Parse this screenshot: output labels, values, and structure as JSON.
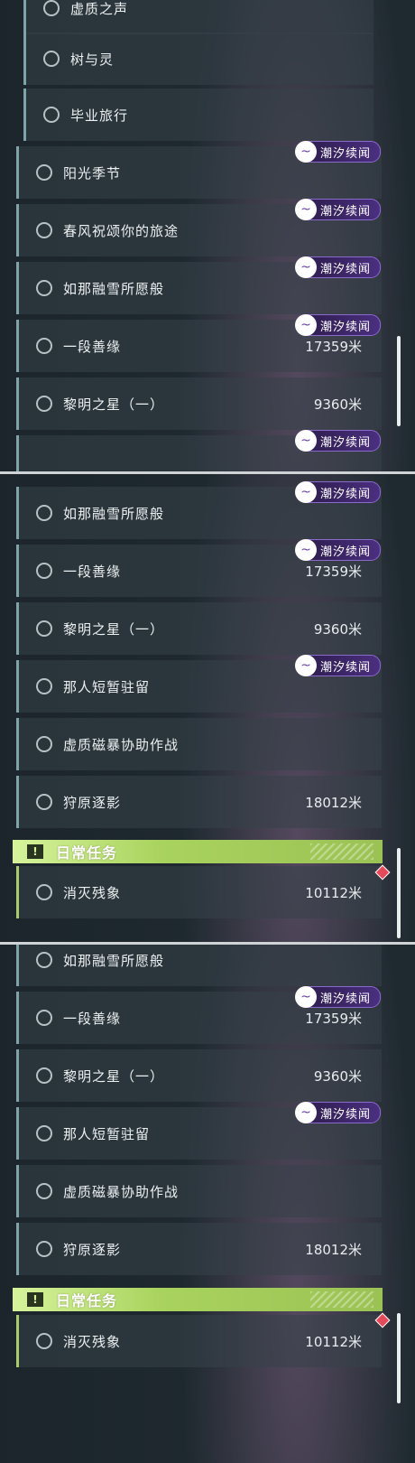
{
  "panels": [
    {
      "rows": [
        {
          "label": "虚质之声",
          "dist": "",
          "badge": false
        },
        {
          "label": "树与灵",
          "dist": "",
          "badge": false
        },
        {
          "label": "毕业旅行",
          "dist": "",
          "badge": false
        },
        {
          "label": "阳光季节",
          "dist": "",
          "badge": true
        },
        {
          "label": "春风祝颂你的旅途",
          "dist": "",
          "badge": true
        },
        {
          "label": "如那融雪所愿般",
          "dist": "",
          "badge": true
        },
        {
          "label": "一段善缘",
          "dist": "17359米",
          "badge": true
        },
        {
          "label": "黎明之星（一）",
          "dist": "9360米",
          "badge": false
        }
      ],
      "extra_badge": true
    },
    {
      "rows": [
        {
          "label": "如那融雪所愿般",
          "dist": "",
          "badge": true
        },
        {
          "label": "一段善缘",
          "dist": "17359米",
          "badge": true
        },
        {
          "label": "黎明之星（一）",
          "dist": "9360米",
          "badge": false
        },
        {
          "label": "那人短暂驻留",
          "dist": "",
          "badge": true
        },
        {
          "label": "虚质磁暴协助作战",
          "dist": "",
          "badge": false
        },
        {
          "label": "狩原逐影",
          "dist": "18012米",
          "badge": false
        }
      ],
      "section": {
        "title": "日常任务",
        "icon": "!"
      },
      "daily": {
        "label": "消灭残象",
        "dist": "10112米"
      }
    },
    {
      "rows": [
        {
          "label": "如那融雪所愿般",
          "dist": "",
          "badge": false
        },
        {
          "label": "一段善缘",
          "dist": "17359米",
          "badge": true
        },
        {
          "label": "黎明之星（一）",
          "dist": "9360米",
          "badge": false
        },
        {
          "label": "那人短暂驻留",
          "dist": "",
          "badge": true
        },
        {
          "label": "虚质磁暴协助作战",
          "dist": "",
          "badge": false
        },
        {
          "label": "狩原逐影",
          "dist": "18012米",
          "badge": false
        }
      ],
      "section": {
        "title": "日常任务",
        "icon": "!"
      },
      "daily": {
        "label": "消灭残象",
        "dist": "10112米"
      }
    }
  ],
  "badge_text": "潮汐续闻",
  "icons": {
    "badge": "wave-icon",
    "quest": "circle-outline-icon",
    "section": "exclamation-icon",
    "tracker": "diamond-icon"
  },
  "colors": {
    "accent_green": "#aacb6a",
    "badge_purple": "#4b2f80",
    "bar_blue": "#7fa3ab"
  }
}
